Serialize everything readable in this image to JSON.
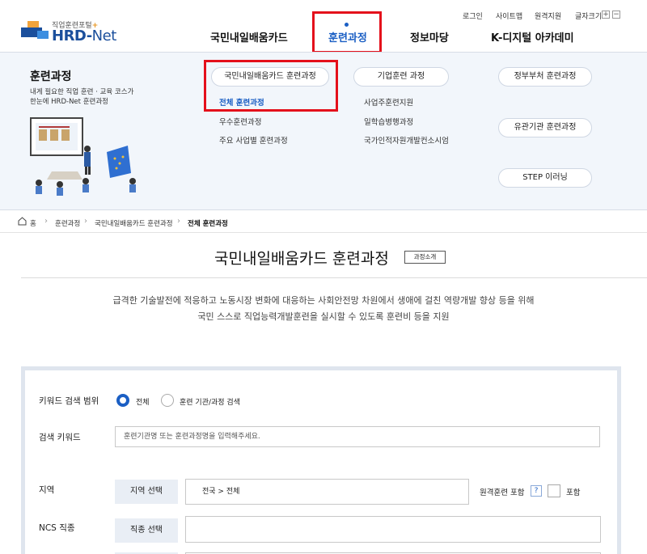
{
  "header": {
    "logo_subtitle_prefix": "직업훈련포털",
    "logo_plus": "+",
    "logo_hrd": "HRD-",
    "logo_net": "Net",
    "util": {
      "login": "로그인",
      "sitemap": "사이트맵",
      "remote": "원격지원",
      "font_size": "글자크기",
      "plus": "+",
      "minus": "−"
    },
    "nav": [
      "국민내일배움카드",
      "훈련과정",
      "정보마당",
      "K-디지털 아카데미"
    ]
  },
  "mega": {
    "title": "훈련과정",
    "desc_line1": "내게 필요한 직업 훈련 · 교육 코스가",
    "desc_line2": "한눈에 HRD-Net 훈련과정",
    "col1": {
      "head": "국민내일배움카드 훈련과정",
      "items": [
        "전체 훈련과정",
        "우수훈련과정",
        "주요 사업별 훈련과정"
      ]
    },
    "col2": {
      "head": "기업훈련 과정",
      "items": [
        "사업주훈련지원",
        "일학습병행과정",
        "국가인적자원개발컨소시엄"
      ]
    },
    "col3": {
      "items": [
        "정부부처 훈련과정",
        "유관기관 훈련과정",
        "STEP 이러닝"
      ]
    }
  },
  "breadcrumb": {
    "home": "홈",
    "items": [
      "훈련과정",
      "국민내일배움카드 훈련과정",
      "전체 훈련과정"
    ]
  },
  "page": {
    "title": "국민내일배움카드 훈련과정",
    "intro_button": "과정소개",
    "desc_line1": "급격한 기술발전에 적응하고 노동시장 변화에 대응하는 사회안전망 차원에서 생애에 걸친 역량개발 향상 등을 위해",
    "desc_line2": "국민 스스로 직업능력개발훈련을 실시할 수 있도록 훈련비 등을 지원"
  },
  "search": {
    "scope_label": "키워드 검색 범위",
    "scope_all": "전체",
    "scope_org": "훈련 기관/과정 검색",
    "keyword_label": "검색 키워드",
    "keyword_placeholder": "훈련기관명 또는 훈련과정명을 입력해주세요.",
    "region_label": "지역",
    "region_button": "지역 선택",
    "region_value": "전국 > 전체",
    "remote_label": "원격훈련 포함",
    "help": "?",
    "include_label": "포함",
    "ncs_label": "NCS 직종",
    "ncs_button": "직종 선택"
  },
  "colors": {
    "accent": "#1b5fc4",
    "highlight": "#e4101b",
    "panel_bg": "#f2f6fb"
  }
}
